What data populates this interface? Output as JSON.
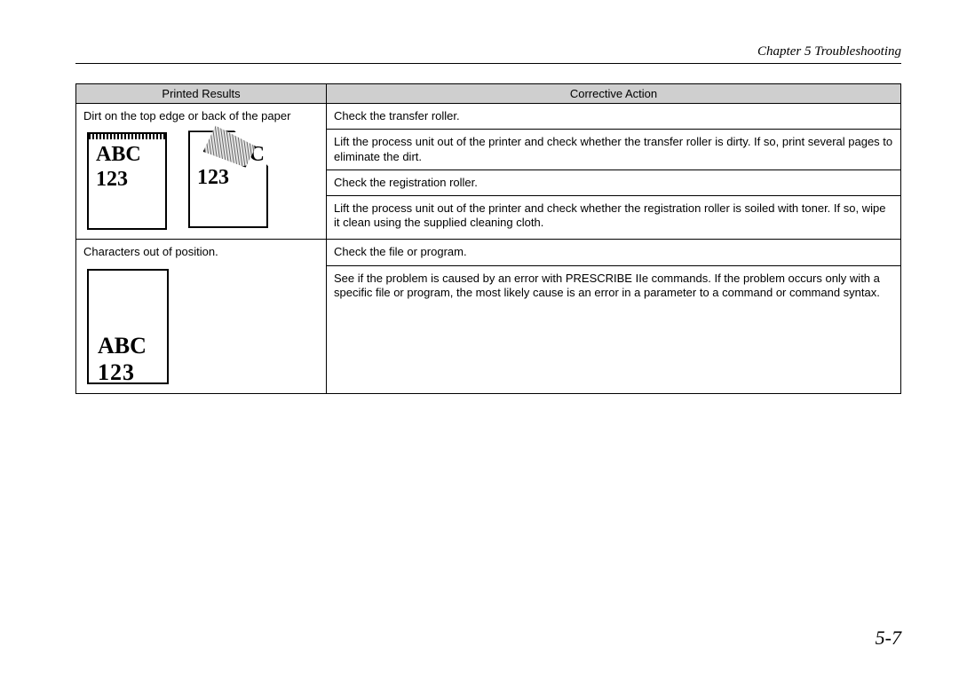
{
  "header": {
    "chapter": "Chapter 5  Troubleshooting"
  },
  "table": {
    "col1": "Printed Results",
    "col2": "Corrective Action"
  },
  "row1": {
    "printed": "Dirt on the top edge or back of the paper",
    "thumb": {
      "abc": "ABC",
      "n123": "123",
      "letterC": "C"
    },
    "actions": [
      "Check the transfer roller.",
      "Lift the process unit out of the printer and check whether the transfer roller is dirty.  If so, print several pages to eliminate the dirt.",
      "Check the registration roller.",
      "Lift the process unit out of the printer and check whether the registration roller is soiled with toner. If so, wipe it clean using the supplied cleaning cloth."
    ]
  },
  "row2": {
    "printed": "Characters out of position.",
    "thumb": {
      "abc": "ABC",
      "n123": "123"
    },
    "actions": [
      "Check the file or program.",
      "See if the problem is caused by an error with PRESCRIBE IIe commands. If the problem occurs only with a specific file or program, the most likely cause is an error in a parameter to a command or command syntax."
    ]
  },
  "pageNumber": "5-7"
}
